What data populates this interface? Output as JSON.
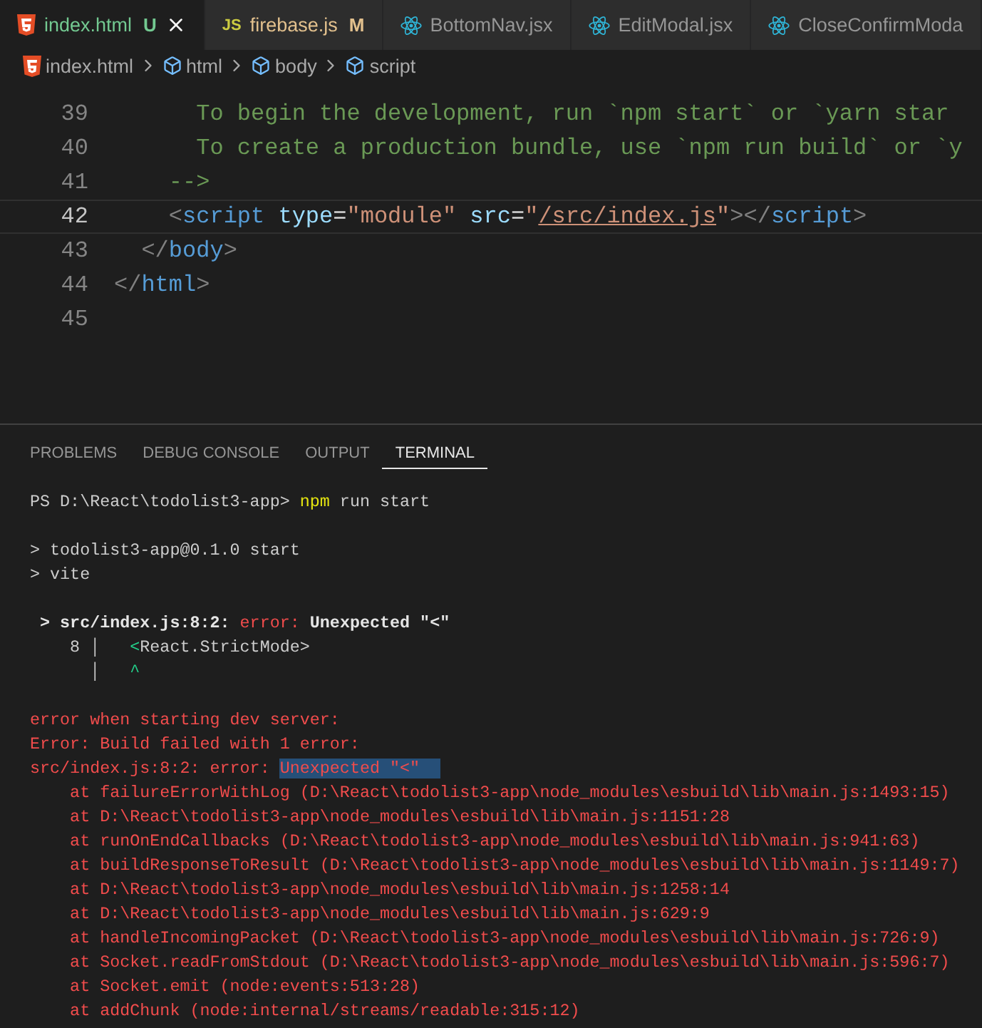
{
  "tabs": [
    {
      "label": "index.html",
      "kind": "html",
      "color": "#73c991",
      "badge": "U",
      "selected": true
    },
    {
      "label": "firebase.js",
      "kind": "js",
      "icon_label": "JS",
      "color": "#e2c08d",
      "badge": "M",
      "selected": false
    },
    {
      "label": "BottomNav.jsx",
      "kind": "react",
      "selected": false
    },
    {
      "label": "EditModal.jsx",
      "kind": "react",
      "selected": false
    },
    {
      "label": "CloseConfirmModa",
      "kind": "react",
      "selected": false
    }
  ],
  "breadcrumb": [
    {
      "label": "index.html",
      "kind": "file"
    },
    {
      "label": "html",
      "kind": "symbol"
    },
    {
      "label": "body",
      "kind": "symbol"
    },
    {
      "label": "script",
      "kind": "symbol"
    }
  ],
  "editor": {
    "lines": [
      {
        "number": "39",
        "current": false,
        "tokens": [
          {
            "text": "      To begin the development, run `npm start` or `yarn star",
            "kind": "comment"
          }
        ]
      },
      {
        "number": "40",
        "current": false,
        "tokens": [
          {
            "text": "      To create a production bundle, use `npm run build` or `y",
            "kind": "comment"
          }
        ]
      },
      {
        "number": "41",
        "current": false,
        "tokens": [
          {
            "text": "    -->",
            "kind": "comment"
          }
        ]
      },
      {
        "number": "42",
        "current": true,
        "tokens": [
          {
            "text": "    <",
            "kind": "bracket"
          },
          {
            "text": "script",
            "kind": "tag"
          },
          {
            "text": " type",
            "kind": "attr"
          },
          {
            "text": "=",
            "kind": "punct"
          },
          {
            "text": "\"module\"",
            "kind": "string"
          },
          {
            "text": " src",
            "kind": "attr"
          },
          {
            "text": "=",
            "kind": "punct"
          },
          {
            "text": "\"",
            "kind": "string"
          },
          {
            "text": "/src/index.js",
            "kind": "link"
          },
          {
            "text": "\"",
            "kind": "string"
          },
          {
            "text": "></",
            "kind": "bracket"
          },
          {
            "text": "script",
            "kind": "tag"
          },
          {
            "text": ">",
            "kind": "bracket"
          }
        ]
      },
      {
        "number": "43",
        "current": false,
        "tokens": [
          {
            "text": "  </",
            "kind": "bracket"
          },
          {
            "text": "body",
            "kind": "tag"
          },
          {
            "text": ">",
            "kind": "bracket"
          }
        ]
      },
      {
        "number": "44",
        "current": false,
        "tokens": [
          {
            "text": "</",
            "kind": "bracket"
          },
          {
            "text": "html",
            "kind": "tag"
          },
          {
            "text": ">",
            "kind": "bracket"
          }
        ]
      },
      {
        "number": "45",
        "current": false
      }
    ]
  },
  "panel": {
    "tabs": [
      {
        "label": "PROBLEMS",
        "selected": false
      },
      {
        "label": "DEBUG CONSOLE",
        "selected": false
      },
      {
        "label": "OUTPUT",
        "selected": false
      },
      {
        "label": "TERMINAL",
        "selected": true
      }
    ],
    "terminal": [
      {
        "lines": [
          [
            {
              "text": "PS D:\\React\\todolist3-app> ",
              "kind": "plain"
            },
            {
              "text": "npm",
              "kind": "command"
            },
            {
              "text": " run start",
              "kind": "plain"
            }
          ]
        ]
      },
      {
        "lines": [
          [
            {
              "text": "> todolist3-app@0.1.0 start",
              "kind": "plain"
            }
          ],
          [
            {
              "text": "> vite",
              "kind": "plain"
            }
          ]
        ]
      },
      {
        "lines": [
          [
            {
              "text": " > src/index.js:8:2: ",
              "kind": "bold"
            },
            {
              "text": "error:",
              "kind": "error"
            },
            {
              "text": " Unexpected \"<\"",
              "kind": "bold"
            }
          ],
          [
            {
              "text": "    8 │   ",
              "kind": "gutter"
            },
            {
              "text": "<",
              "kind": "green"
            },
            {
              "text": "React.StrictMode>",
              "kind": "plain"
            }
          ],
          [
            {
              "text": "      │   ",
              "kind": "gutter"
            },
            {
              "text": "^",
              "kind": "green"
            }
          ]
        ]
      },
      {
        "lines": [
          [
            {
              "text": "error when starting dev server:",
              "kind": "error"
            }
          ],
          [
            {
              "text": "Error: Build failed with 1 error:",
              "kind": "error"
            }
          ],
          [
            {
              "text": "src/index.js:8:2: error: ",
              "kind": "error"
            },
            {
              "text": "Unexpected \"<\"  ",
              "kind": "selection"
            }
          ],
          [
            {
              "text": "    at failureErrorWithLog (D:\\React\\todolist3-app\\node_modules\\esbuild\\lib\\main.js:1493:15)",
              "kind": "error"
            }
          ],
          [
            {
              "text": "    at D:\\React\\todolist3-app\\node_modules\\esbuild\\lib\\main.js:1151:28",
              "kind": "error"
            }
          ],
          [
            {
              "text": "    at runOnEndCallbacks (D:\\React\\todolist3-app\\node_modules\\esbuild\\lib\\main.js:941:63)",
              "kind": "error"
            }
          ],
          [
            {
              "text": "    at buildResponseToResult (D:\\React\\todolist3-app\\node_modules\\esbuild\\lib\\main.js:1149:7)",
              "kind": "error"
            }
          ],
          [
            {
              "text": "    at D:\\React\\todolist3-app\\node_modules\\esbuild\\lib\\main.js:1258:14",
              "kind": "error"
            }
          ],
          [
            {
              "text": "    at D:\\React\\todolist3-app\\node_modules\\esbuild\\lib\\main.js:629:9",
              "kind": "error"
            }
          ],
          [
            {
              "text": "    at handleIncomingPacket (D:\\React\\todolist3-app\\node_modules\\esbuild\\lib\\main.js:726:9)",
              "kind": "error"
            }
          ],
          [
            {
              "text": "    at Socket.readFromStdout (D:\\React\\todolist3-app\\node_modules\\esbuild\\lib\\main.js:596:7)",
              "kind": "error"
            }
          ],
          [
            {
              "text": "    at Socket.emit (node:events:513:28)",
              "kind": "error"
            }
          ],
          [
            {
              "text": "    at addChunk (node:internal/streams/readable:315:12)",
              "kind": "error"
            }
          ]
        ]
      }
    ]
  }
}
